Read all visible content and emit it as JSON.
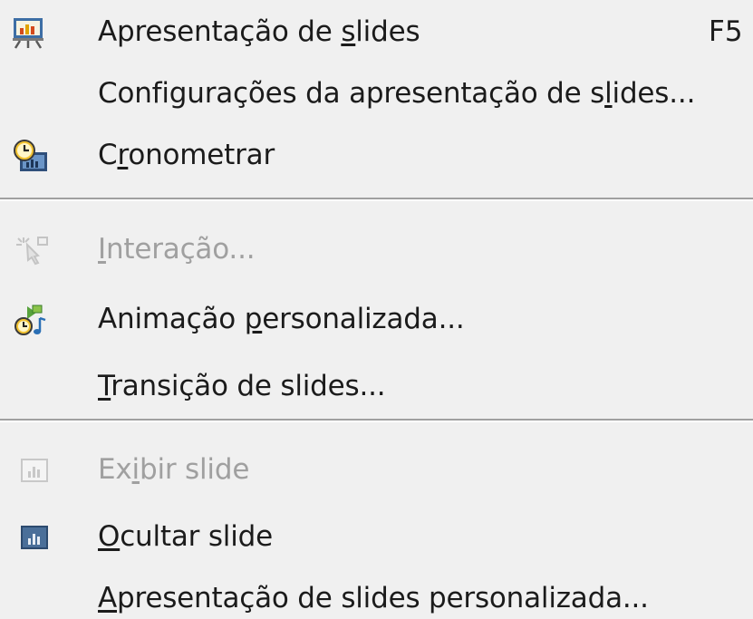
{
  "menu": {
    "items": [
      {
        "pre": "Apresentação de ",
        "key": "s",
        "post": "lides",
        "shortcut": "F5",
        "icon": "presentation-icon",
        "enabled": true
      },
      {
        "pre": "Configurações da apresentação de s",
        "key": "l",
        "post": "ides...",
        "icon": "",
        "enabled": true
      },
      {
        "pre": "C",
        "key": "r",
        "post": "onometrar",
        "icon": "rehearse-timings-icon",
        "enabled": true
      },
      {
        "pre": "",
        "key": "I",
        "post": "nteração...",
        "icon": "interaction-icon",
        "enabled": false
      },
      {
        "pre": "Animação ",
        "key": "p",
        "post": "ersonalizada...",
        "icon": "custom-animation-icon",
        "enabled": true
      },
      {
        "pre": "",
        "key": "T",
        "post": "ransição de slides...",
        "icon": "",
        "enabled": true
      },
      {
        "pre": "Ex",
        "key": "i",
        "post": "bir slide",
        "icon": "show-slide-icon",
        "enabled": false
      },
      {
        "pre": "",
        "key": "O",
        "post": "cultar slide",
        "icon": "hide-slide-icon",
        "enabled": true
      },
      {
        "pre": "",
        "key": "A",
        "post": "presentação de slides personalizada...",
        "icon": "",
        "enabled": true
      }
    ]
  },
  "colors": {
    "background": "#f0f0f0",
    "text": "#1b1b1b",
    "disabled_text": "#a0a0a0",
    "separator": "#a0a0a0"
  }
}
